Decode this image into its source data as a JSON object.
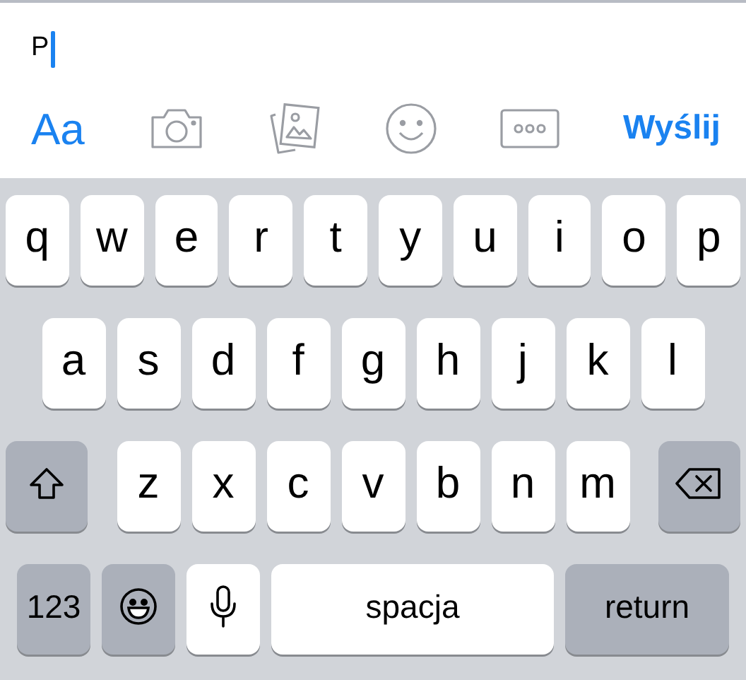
{
  "message": {
    "value": "P"
  },
  "toolbar": [
    {
      "kind": "text",
      "label": "Aa"
    },
    {
      "kind": "camera"
    },
    {
      "kind": "photos"
    },
    {
      "kind": "emoji"
    },
    {
      "kind": "more"
    },
    {
      "kind": "send",
      "label": "Wyślij"
    }
  ],
  "keyboard": {
    "rows": [
      {
        "keys": [
          {
            "kind": "letter",
            "label": "q"
          },
          {
            "kind": "letter",
            "label": "w"
          },
          {
            "kind": "letter",
            "label": "e"
          },
          {
            "kind": "letter",
            "label": "r"
          },
          {
            "kind": "letter",
            "label": "t"
          },
          {
            "kind": "letter",
            "label": "y"
          },
          {
            "kind": "letter",
            "label": "u"
          },
          {
            "kind": "letter",
            "label": "i"
          },
          {
            "kind": "letter",
            "label": "o"
          },
          {
            "kind": "letter",
            "label": "p"
          }
        ]
      },
      {
        "keys": [
          {
            "kind": "letter",
            "label": "a"
          },
          {
            "kind": "letter",
            "label": "s"
          },
          {
            "kind": "letter",
            "label": "d"
          },
          {
            "kind": "letter",
            "label": "f"
          },
          {
            "kind": "letter",
            "label": "g"
          },
          {
            "kind": "letter",
            "label": "h"
          },
          {
            "kind": "letter",
            "label": "j"
          },
          {
            "kind": "letter",
            "label": "k"
          },
          {
            "kind": "letter",
            "label": "l"
          }
        ]
      },
      {
        "keys": [
          {
            "kind": "shift",
            "on": false
          },
          {
            "kind": "letter",
            "label": "z"
          },
          {
            "kind": "letter",
            "label": "x"
          },
          {
            "kind": "letter",
            "label": "c"
          },
          {
            "kind": "letter",
            "label": "v"
          },
          {
            "kind": "letter",
            "label": "b"
          },
          {
            "kind": "letter",
            "label": "n"
          },
          {
            "kind": "letter",
            "label": "m"
          },
          {
            "kind": "backspace"
          }
        ]
      },
      {
        "keys": [
          {
            "kind": "numbers",
            "label": "123"
          },
          {
            "kind": "emoji"
          },
          {
            "kind": "mic"
          },
          {
            "kind": "space",
            "label": "spacja"
          },
          {
            "kind": "return",
            "label": "return"
          }
        ]
      }
    ]
  }
}
